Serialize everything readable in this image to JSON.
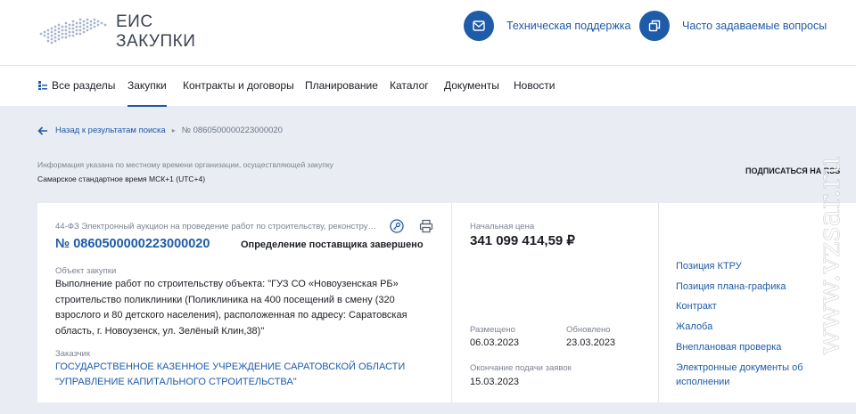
{
  "header": {
    "logo_line1": "ЕИС",
    "logo_line2": "ЗАКУПКИ",
    "support_label": "Техническая поддержка",
    "faq_label": "Часто задаваемые вопросы",
    "accent_color": "#1e5ba8"
  },
  "nav": {
    "items": [
      {
        "label": "Все разделы",
        "icon": "sections-icon"
      },
      {
        "label": "Закупки",
        "active": true
      },
      {
        "label": "Контракты и договоры"
      },
      {
        "label": "Планирование"
      },
      {
        "label": "Каталог"
      },
      {
        "label": "Документы"
      },
      {
        "label": "Новости"
      }
    ]
  },
  "breadcrumb": {
    "back_label": "Назад к результатам поиска",
    "current": "№ 0860500000223000020"
  },
  "timezone": {
    "info": "Информация указана по местному времени организации, осуществляющей закупку",
    "value": "Самарское стандартное время МСК+1 (UTC+4)"
  },
  "rss_label": "ПОДПИСАТЬСЯ НА RSS",
  "purchase": {
    "law": "44-ФЗ Электронный аукцион на проведение работ по строительству, реконструкц...",
    "number": "№ 0860500000223000020",
    "status": "Определение поставщика завершено",
    "object_label": "Объект закупки",
    "object_value": "Выполнение работ по строительству объекта: \"ГУЗ СО «Новоузенская РБ» строительство поликлиники (Поликлиника на 400 посещений в смену (320 взрослого и 80 детского населения), расположенная по адресу: Саратовская область, г. Новоузенск, ул. Зелёный Клин,38)\"",
    "customer_label": "Заказчик",
    "customer_value": "ГОСУДАРСТВЕННОЕ КАЗЕННОЕ УЧРЕЖДЕНИЕ САРАТОВСКОЙ ОБЛАСТИ \"УПРАВЛЕНИЕ КАПИТАЛЬНОГО СТРОИТЕЛЬСТВА\"",
    "price_label": "Начальная цена",
    "price_value": "341 099 414,59 ₽",
    "posted_label": "Размещено",
    "posted_value": "06.03.2023",
    "updated_label": "Обновлено",
    "updated_value": "23.03.2023",
    "deadline_label": "Окончание подачи заявок",
    "deadline_value": "15.03.2023"
  },
  "links": [
    "Позиция КТРУ",
    "Позиция плана-графика",
    "Контракт",
    "Жалоба",
    "Внеплановая проверка",
    "Электронные документы об исполнении"
  ],
  "watermark": "www.vzsar.ru"
}
